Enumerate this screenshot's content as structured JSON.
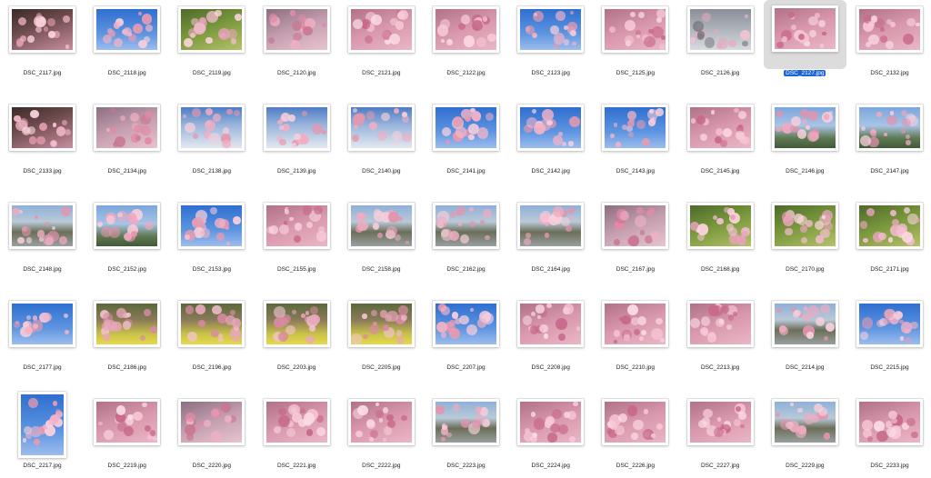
{
  "window": {
    "view": "icon-grid"
  },
  "selected_index": 9,
  "colors": {
    "selection_bg": "#1a64d8",
    "selection_text": "#ffffff",
    "selected_tile_bg": "#dcdcdc",
    "label_text": "#1a1a1a"
  },
  "files": [
    {
      "name": "DSC_2117.jpg",
      "icon": "photo-thumbnail",
      "scene": "blossom-dark",
      "orientation": "landscape"
    },
    {
      "name": "DSC_2118.jpg",
      "icon": "photo-thumbnail",
      "scene": "blossom-sky",
      "orientation": "landscape"
    },
    {
      "name": "DSC_2119.jpg",
      "icon": "photo-thumbnail",
      "scene": "blossom-green",
      "orientation": "landscape"
    },
    {
      "name": "DSC_2120.jpg",
      "icon": "photo-thumbnail",
      "scene": "blossom-bokeh",
      "orientation": "landscape"
    },
    {
      "name": "DSC_2121.jpg",
      "icon": "photo-thumbnail",
      "scene": "blossom-dense",
      "orientation": "landscape"
    },
    {
      "name": "DSC_2122.jpg",
      "icon": "photo-thumbnail",
      "scene": "blossom-dense",
      "orientation": "landscape"
    },
    {
      "name": "DSC_2123.jpg",
      "icon": "photo-thumbnail",
      "scene": "blossom-sky",
      "orientation": "landscape"
    },
    {
      "name": "DSC_2125.jpg",
      "icon": "photo-thumbnail",
      "scene": "blossom-dense",
      "orientation": "landscape"
    },
    {
      "name": "DSC_2126.jpg",
      "icon": "photo-thumbnail",
      "scene": "blossom-grey",
      "orientation": "landscape"
    },
    {
      "name": "DSC_2127.jpg",
      "icon": "photo-thumbnail",
      "scene": "blossom-dense",
      "orientation": "landscape"
    },
    {
      "name": "DSC_2132.jpg",
      "icon": "photo-thumbnail",
      "scene": "blossom-dense",
      "orientation": "landscape"
    },
    {
      "name": "DSC_2133.jpg",
      "icon": "photo-thumbnail",
      "scene": "blossom-dark",
      "orientation": "landscape"
    },
    {
      "name": "DSC_2134.jpg",
      "icon": "photo-thumbnail",
      "scene": "blossom-bokeh",
      "orientation": "landscape"
    },
    {
      "name": "DSC_2138.jpg",
      "icon": "photo-thumbnail",
      "scene": "blossom-cloud",
      "orientation": "landscape"
    },
    {
      "name": "DSC_2139.jpg",
      "icon": "photo-thumbnail",
      "scene": "blossom-cloud",
      "orientation": "landscape"
    },
    {
      "name": "DSC_2140.jpg",
      "icon": "photo-thumbnail",
      "scene": "blossom-cloud",
      "orientation": "landscape"
    },
    {
      "name": "DSC_2141.jpg",
      "icon": "photo-thumbnail",
      "scene": "blossom-sky",
      "orientation": "landscape"
    },
    {
      "name": "DSC_2142.jpg",
      "icon": "photo-thumbnail",
      "scene": "blossom-sky",
      "orientation": "landscape"
    },
    {
      "name": "DSC_2143.jpg",
      "icon": "photo-thumbnail",
      "scene": "blossom-sky",
      "orientation": "landscape"
    },
    {
      "name": "DSC_2145.jpg",
      "icon": "photo-thumbnail",
      "scene": "blossom-dense",
      "orientation": "landscape"
    },
    {
      "name": "DSC_2146.jpg",
      "icon": "photo-thumbnail",
      "scene": "blossom-hill",
      "orientation": "landscape"
    },
    {
      "name": "DSC_2147.jpg",
      "icon": "photo-thumbnail",
      "scene": "blossom-hill",
      "orientation": "landscape"
    },
    {
      "name": "DSC_2148.jpg",
      "icon": "photo-thumbnail",
      "scene": "blossom-river",
      "orientation": "landscape"
    },
    {
      "name": "DSC_2152.jpg",
      "icon": "photo-thumbnail",
      "scene": "blossom-hill",
      "orientation": "landscape"
    },
    {
      "name": "DSC_2153.jpg",
      "icon": "photo-thumbnail",
      "scene": "blossom-sky",
      "orientation": "landscape"
    },
    {
      "name": "DSC_2155.jpg",
      "icon": "photo-thumbnail",
      "scene": "blossom-dense",
      "orientation": "landscape"
    },
    {
      "name": "DSC_2158.jpg",
      "icon": "photo-thumbnail",
      "scene": "blossom-river",
      "orientation": "landscape"
    },
    {
      "name": "DSC_2162.jpg",
      "icon": "photo-thumbnail",
      "scene": "blossom-river",
      "orientation": "landscape"
    },
    {
      "name": "DSC_2164.jpg",
      "icon": "photo-thumbnail",
      "scene": "blossom-river",
      "orientation": "landscape"
    },
    {
      "name": "DSC_2167.jpg",
      "icon": "photo-thumbnail",
      "scene": "blossom-bokeh",
      "orientation": "landscape"
    },
    {
      "name": "DSC_2168.jpg",
      "icon": "photo-thumbnail",
      "scene": "blossom-green",
      "orientation": "landscape"
    },
    {
      "name": "DSC_2170.jpg",
      "icon": "photo-thumbnail",
      "scene": "blossom-green",
      "orientation": "landscape"
    },
    {
      "name": "DSC_2171.jpg",
      "icon": "photo-thumbnail",
      "scene": "blossom-green",
      "orientation": "landscape"
    },
    {
      "name": "DSC_2177.jpg",
      "icon": "photo-thumbnail",
      "scene": "blossom-sky",
      "orientation": "landscape"
    },
    {
      "name": "DSC_2186.jpg",
      "icon": "photo-thumbnail",
      "scene": "blossom-yellow",
      "orientation": "landscape"
    },
    {
      "name": "DSC_2196.jpg",
      "icon": "photo-thumbnail",
      "scene": "blossom-yellow",
      "orientation": "landscape"
    },
    {
      "name": "DSC_2203.jpg",
      "icon": "photo-thumbnail",
      "scene": "blossom-yellow",
      "orientation": "landscape"
    },
    {
      "name": "DSC_2205.jpg",
      "icon": "photo-thumbnail",
      "scene": "blossom-yellow",
      "orientation": "landscape"
    },
    {
      "name": "DSC_2207.jpg",
      "icon": "photo-thumbnail",
      "scene": "blossom-sky",
      "orientation": "landscape"
    },
    {
      "name": "DSC_2208.jpg",
      "icon": "photo-thumbnail",
      "scene": "blossom-dense",
      "orientation": "landscape"
    },
    {
      "name": "DSC_2210.jpg",
      "icon": "photo-thumbnail",
      "scene": "blossom-dense",
      "orientation": "landscape"
    },
    {
      "name": "DSC_2213.jpg",
      "icon": "photo-thumbnail",
      "scene": "blossom-dense",
      "orientation": "landscape"
    },
    {
      "name": "DSC_2214.jpg",
      "icon": "photo-thumbnail",
      "scene": "blossom-river",
      "orientation": "landscape"
    },
    {
      "name": "DSC_2215.jpg",
      "icon": "photo-thumbnail",
      "scene": "blossom-sky",
      "orientation": "landscape"
    },
    {
      "name": "DSC_2217.jpg",
      "icon": "photo-thumbnail",
      "scene": "blossom-sky",
      "orientation": "portrait"
    },
    {
      "name": "DSC_2219.jpg",
      "icon": "photo-thumbnail",
      "scene": "blossom-dense",
      "orientation": "landscape"
    },
    {
      "name": "DSC_2220.jpg",
      "icon": "photo-thumbnail",
      "scene": "blossom-bokeh",
      "orientation": "landscape"
    },
    {
      "name": "DSC_2221.jpg",
      "icon": "photo-thumbnail",
      "scene": "blossom-dense",
      "orientation": "landscape"
    },
    {
      "name": "DSC_2222.jpg",
      "icon": "photo-thumbnail",
      "scene": "blossom-dense",
      "orientation": "landscape"
    },
    {
      "name": "DSC_2223.jpg",
      "icon": "photo-thumbnail",
      "scene": "blossom-river",
      "orientation": "landscape"
    },
    {
      "name": "DSC_2224.jpg",
      "icon": "photo-thumbnail",
      "scene": "blossom-dense",
      "orientation": "landscape"
    },
    {
      "name": "DSC_2226.jpg",
      "icon": "photo-thumbnail",
      "scene": "blossom-dense",
      "orientation": "landscape"
    },
    {
      "name": "DSC_2227.jpg",
      "icon": "photo-thumbnail",
      "scene": "blossom-dense",
      "orientation": "landscape"
    },
    {
      "name": "DSC_2229.jpg",
      "icon": "photo-thumbnail",
      "scene": "blossom-river",
      "orientation": "landscape"
    },
    {
      "name": "DSC_2233.jpg",
      "icon": "photo-thumbnail",
      "scene": "blossom-dense",
      "orientation": "landscape"
    }
  ]
}
